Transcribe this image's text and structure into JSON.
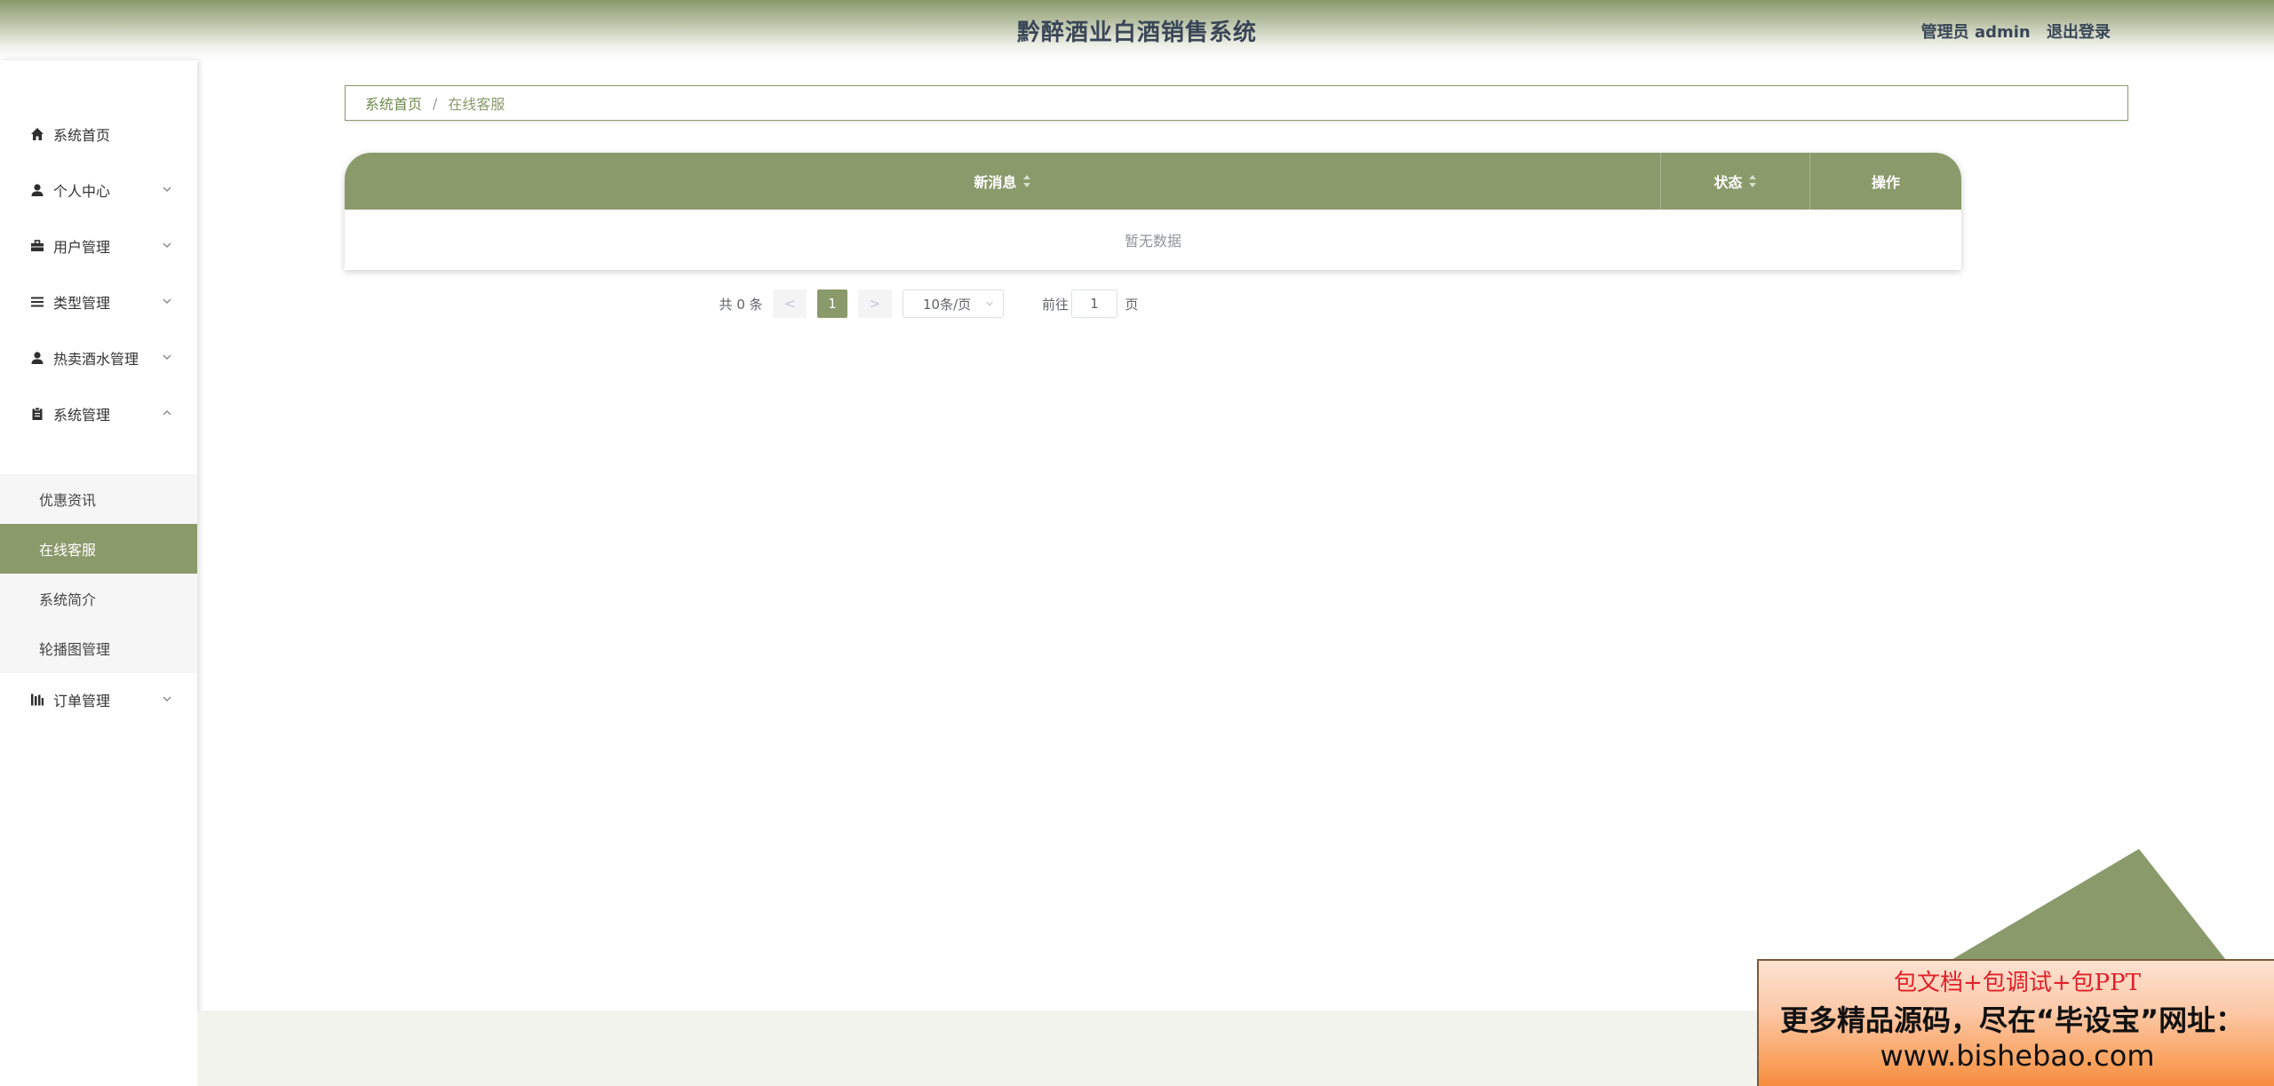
{
  "header": {
    "title": "黔醉酒业白酒销售系统",
    "user_label": "管理员 admin",
    "logout_label": "退出登录"
  },
  "sidebar": {
    "items": [
      {
        "label": "系统首页",
        "icon": "home-icon"
      },
      {
        "label": "个人中心",
        "icon": "user-icon"
      },
      {
        "label": "用户管理",
        "icon": "briefcase-icon"
      },
      {
        "label": "类型管理",
        "icon": "list-icon"
      },
      {
        "label": "热卖酒水管理",
        "icon": "user-icon"
      },
      {
        "label": "系统管理",
        "icon": "clipboard-icon"
      },
      {
        "label": "订单管理",
        "icon": "bar-chart-icon"
      }
    ],
    "subitems": [
      {
        "label": "优惠资讯"
      },
      {
        "label": "在线客服"
      },
      {
        "label": "系统简介"
      },
      {
        "label": "轮播图管理"
      }
    ]
  },
  "breadcrumb": {
    "home": "系统首页",
    "separator": "/",
    "current": "在线客服"
  },
  "table": {
    "columns": [
      "新消息",
      "状态",
      "操作"
    ],
    "empty_text": "暂无数据"
  },
  "pagination": {
    "total_text": "共 0 条",
    "prev": "<",
    "current_page": "1",
    "next": ">",
    "page_size": "10条/页",
    "goto_label": "前往",
    "goto_value": "1",
    "page_suffix": "页"
  },
  "promo": {
    "line1": "包文档+包调试+包PPT",
    "line2": "更多精品源码，尽在“毕设宝”网址：",
    "line3": "www.bishebao.com"
  },
  "colors": {
    "accent": "#8a9a6b",
    "header_text": "#3a4657"
  }
}
